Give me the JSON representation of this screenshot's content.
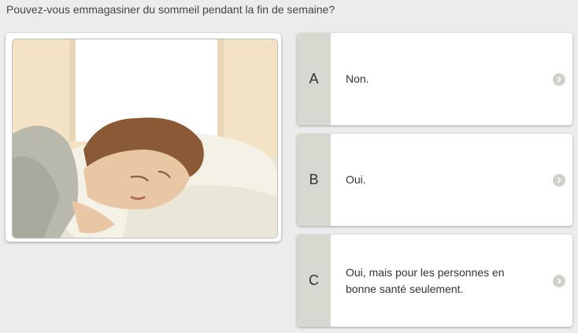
{
  "question": "Pouvez-vous emmagasiner du sommeil pendant la fin de semaine?",
  "illustration": {
    "icon": "sleeping-person-illustration",
    "colors": {
      "wall": "#f3e2c4",
      "window": "#ffffff",
      "hair": "#8a5a36",
      "skin": "#e9c6a4",
      "pillow": "#f4f1e6",
      "blanket": "#b8b8ad"
    }
  },
  "options": [
    {
      "letter": "A",
      "text": "Non."
    },
    {
      "letter": "B",
      "text": "Oui."
    },
    {
      "letter": "C",
      "text": "Oui, mais pour les personnes en bonne santé seulement."
    }
  ],
  "arrow_icon": "chevron-right-circle-icon",
  "colors": {
    "page_bg": "#ececec",
    "letter_bg": "#d6d9d0",
    "arrow_bg": "#cfd2c8"
  }
}
